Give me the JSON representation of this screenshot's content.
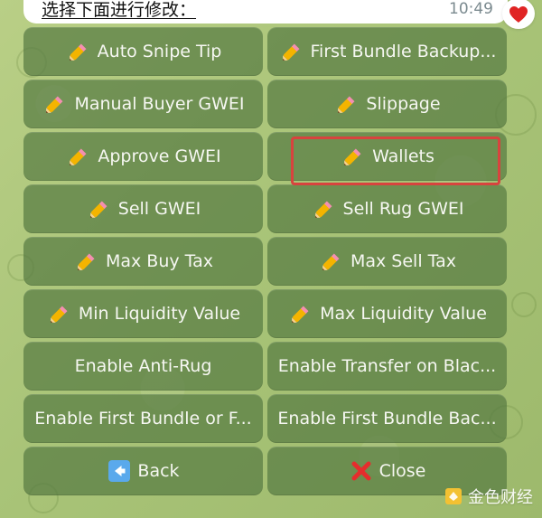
{
  "message": {
    "text": "选择下面进行修改：",
    "time": "10:49"
  },
  "reaction": {
    "icon": "heart-icon",
    "color": "#e02424"
  },
  "highlight": {
    "target": "wallets-button",
    "color": "#d8433e"
  },
  "keyboard": {
    "buttons": [
      {
        "label": "Auto Snipe Tip",
        "icon": "pencil-icon"
      },
      {
        "label": "First Bundle Backup...",
        "icon": "pencil-icon"
      },
      {
        "label": "Manual Buyer GWEI",
        "icon": "pencil-icon"
      },
      {
        "label": "Slippage",
        "icon": "pencil-icon"
      },
      {
        "label": "Approve GWEI",
        "icon": "pencil-icon"
      },
      {
        "label": "Wallets",
        "icon": "pencil-icon"
      },
      {
        "label": "Sell GWEI",
        "icon": "pencil-icon"
      },
      {
        "label": "Sell Rug GWEI",
        "icon": "pencil-icon"
      },
      {
        "label": "Max Buy Tax",
        "icon": "pencil-icon"
      },
      {
        "label": "Max Sell Tax",
        "icon": "pencil-icon"
      },
      {
        "label": "Min Liquidity Value",
        "icon": "pencil-icon"
      },
      {
        "label": "Max Liquidity Value",
        "icon": "pencil-icon"
      },
      {
        "label": "Enable Anti-Rug"
      },
      {
        "label": "Enable Transfer on Blac..."
      },
      {
        "label": "Enable First Bundle or F..."
      },
      {
        "label": "Enable First Bundle Bac..."
      },
      {
        "label": "Back",
        "icon": "back-arrow-icon"
      },
      {
        "label": "Close",
        "icon": "close-icon"
      }
    ]
  },
  "watermark": {
    "text": "金色财经",
    "icon": "watermark-logo-icon"
  }
}
